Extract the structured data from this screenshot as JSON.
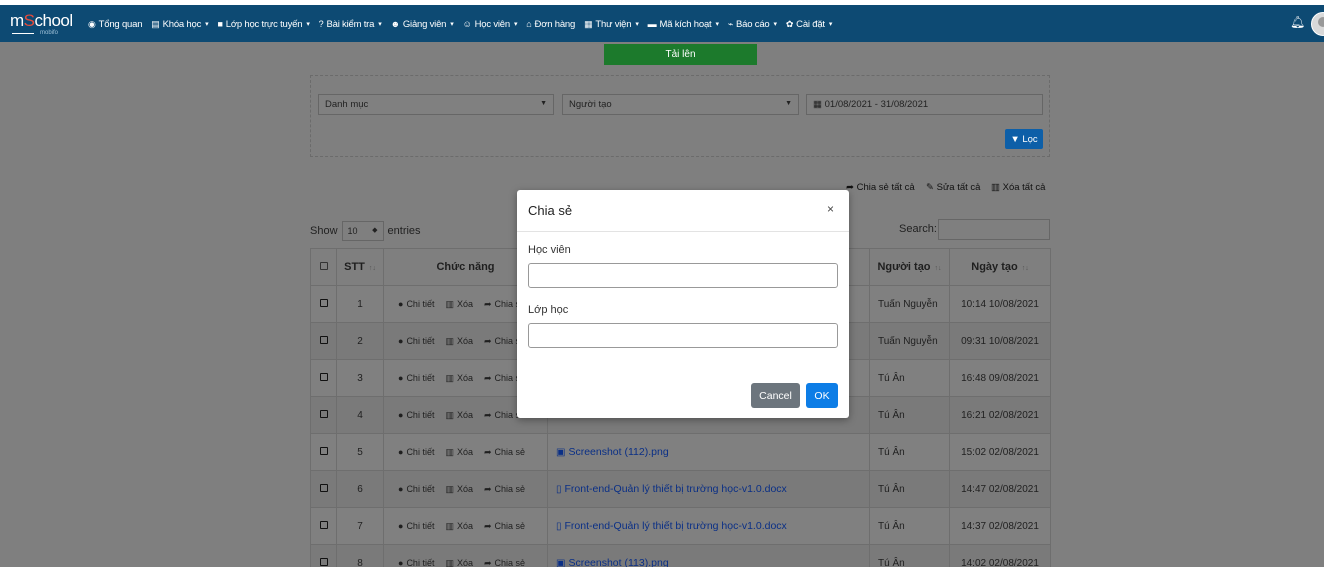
{
  "logo": {
    "text_m": "m",
    "text_o": "S",
    "text_rest": "chool",
    "sub": "mobifo"
  },
  "nav": [
    {
      "icon": "dashboard-icon",
      "glyph": "◉",
      "label": "Tổng quan",
      "caret": false
    },
    {
      "icon": "book-icon",
      "glyph": "▤",
      "label": "Khóa học",
      "caret": true
    },
    {
      "icon": "video-icon",
      "glyph": "■",
      "label": "Lớp học trực tuyến",
      "caret": true
    },
    {
      "icon": "question-icon",
      "glyph": "?",
      "label": "Bài kiểm tra",
      "caret": true
    },
    {
      "icon": "users-icon",
      "glyph": "☻",
      "label": "Giảng viên",
      "caret": true
    },
    {
      "icon": "user-icon",
      "glyph": "☺",
      "label": "Học viên",
      "caret": true
    },
    {
      "icon": "cart-icon",
      "glyph": "⌂",
      "label": "Đơn hàng",
      "caret": false
    },
    {
      "icon": "library-icon",
      "glyph": "▦",
      "label": "Thư viện",
      "caret": true
    },
    {
      "icon": "barcode-icon",
      "glyph": "▬",
      "label": "Mã kích hoạt",
      "caret": true
    },
    {
      "icon": "chart-icon",
      "glyph": "⌁",
      "label": "Báo cáo",
      "caret": true
    },
    {
      "icon": "gears-icon",
      "glyph": "✿",
      "label": "Cài đặt",
      "caret": true
    }
  ],
  "upload_label": "Tải lên",
  "filters": {
    "category_placeholder": "Danh mục",
    "creator_placeholder": "Người tạo",
    "date_range": "01/08/2021 - 31/08/2021",
    "filter_label": "Lọc"
  },
  "bulk": {
    "share_all": "Chia sẻ tất cả",
    "edit_all": "Sửa tất cả",
    "delete_all": "Xóa tất cả"
  },
  "table_controls": {
    "show": "Show",
    "length": "10",
    "entries": "entries",
    "search": "Search:"
  },
  "columns": {
    "stt": "STT",
    "actions": "Chức năng",
    "creator": "Người tạo",
    "created": "Ngày tạo"
  },
  "actions": {
    "detail": "Chi tiết",
    "delete": "Xóa",
    "share": "Chia sẻ"
  },
  "rows": [
    {
      "stt": "1",
      "file": "",
      "file_icon": "",
      "creator": "Tuấn Nguyễn",
      "created": "10:14 10/08/2021"
    },
    {
      "stt": "2",
      "file": "",
      "file_icon": "",
      "creator": "Tuấn Nguyễn",
      "created": "09:31 10/08/2021"
    },
    {
      "stt": "3",
      "file": "",
      "file_icon": "",
      "creator": "Tú Ân",
      "created": "16:48 09/08/2021"
    },
    {
      "stt": "4",
      "file": "",
      "file_icon": "",
      "creator": "Tú Ân",
      "created": "16:21 02/08/2021"
    },
    {
      "stt": "5",
      "file": "Screenshot (112).png",
      "file_icon": "image-icon",
      "creator": "Tú Ân",
      "created": "15:02 02/08/2021"
    },
    {
      "stt": "6",
      "file": "Front-end-Quản lý thiết bị trường học-v1.0.docx",
      "file_icon": "file-icon",
      "creator": "Tú Ân",
      "created": "14:47 02/08/2021"
    },
    {
      "stt": "7",
      "file": "Front-end-Quản lý thiết bị trường học-v1.0.docx",
      "file_icon": "file-icon",
      "creator": "Tú Ân",
      "created": "14:37 02/08/2021"
    },
    {
      "stt": "8",
      "file": "Screenshot (113).png",
      "file_icon": "image-icon",
      "creator": "Tú Ân",
      "created": "14:02 02/08/2021"
    }
  ],
  "modal": {
    "title": "Chia sẻ",
    "close": "×",
    "student_label": "Học viên",
    "student_value": "",
    "class_label": "Lớp học",
    "class_value": "",
    "cancel_label": "Cancel",
    "ok_label": "OK"
  }
}
